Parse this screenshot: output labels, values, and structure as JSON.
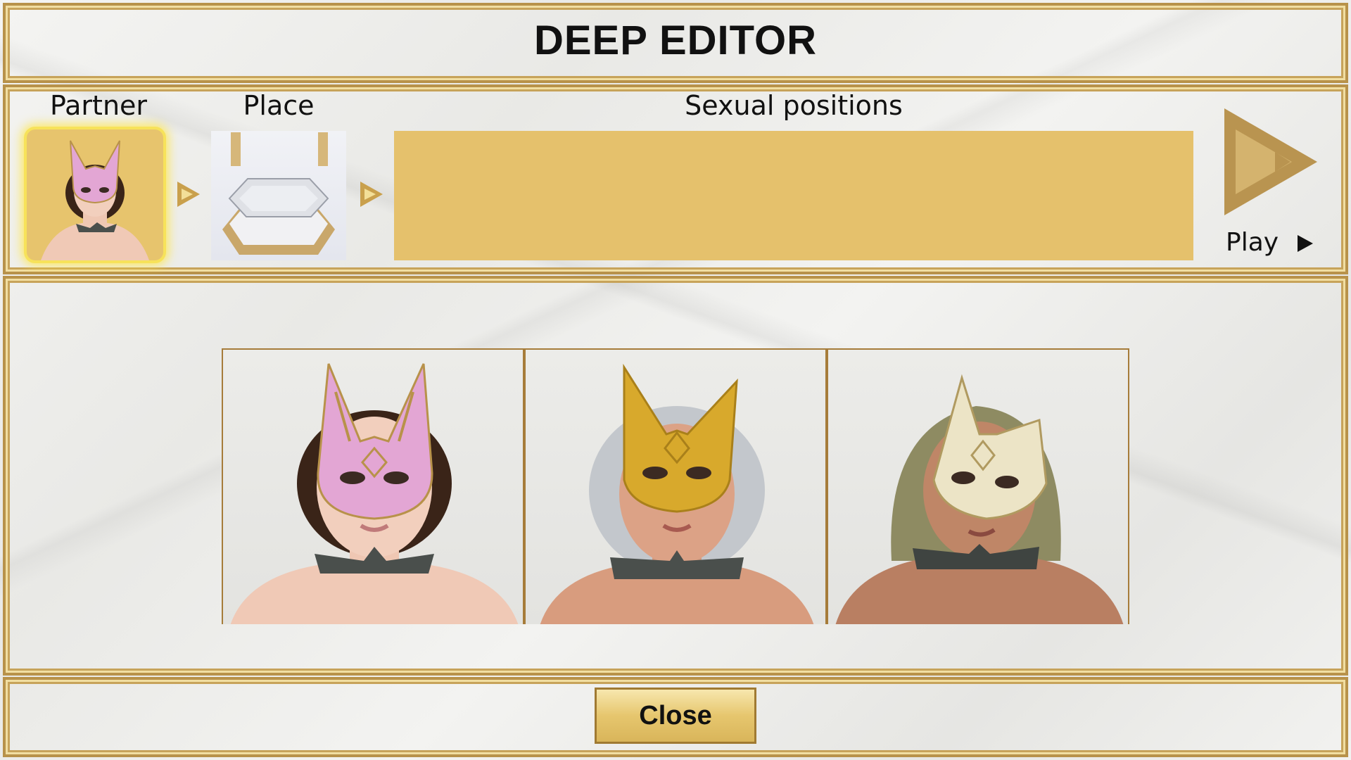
{
  "title": "DEEP EDITOR",
  "steps": {
    "partner_label": "Partner",
    "place_label": "Place",
    "positions_label": "Sexual positions"
  },
  "play": {
    "label": "Play",
    "arrow_icon": "play-icon"
  },
  "characters": [
    {
      "mask": "pink rabbit mask",
      "mask_color": "#e3a6d4",
      "hair_color": "#3a2418"
    },
    {
      "mask": "gold fox mask",
      "mask_color": "#d8a92c",
      "hair_color": "#c3c7cc"
    },
    {
      "mask": "ivory cat mask",
      "mask_color": "#ece4c6",
      "hair_color": "#8e8b62"
    }
  ],
  "colors": {
    "gold_border": "#b8924a",
    "panel_gold": "#e5c16c",
    "highlight": "#f7e25a"
  },
  "close_label": "Close"
}
